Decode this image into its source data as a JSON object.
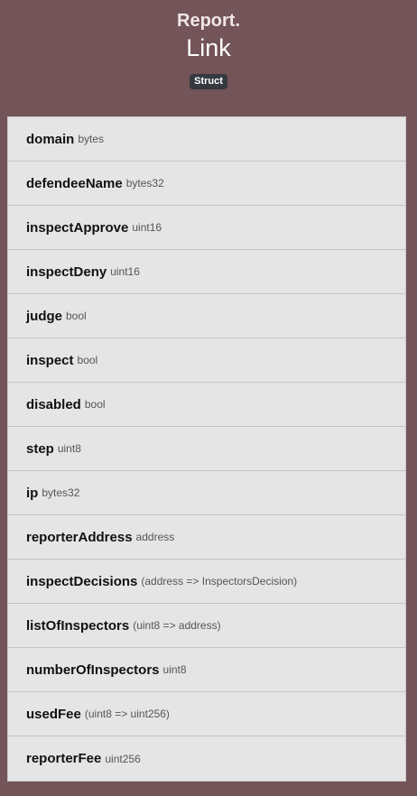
{
  "header": {
    "parent": "Report.",
    "title": "Link",
    "badge": "Struct"
  },
  "fields": [
    {
      "name": "domain",
      "type": "bytes"
    },
    {
      "name": "defendeeName",
      "type": "bytes32"
    },
    {
      "name": "inspectApprove",
      "type": "uint16"
    },
    {
      "name": "inspectDeny",
      "type": "uint16"
    },
    {
      "name": "judge",
      "type": "bool"
    },
    {
      "name": "inspect",
      "type": "bool"
    },
    {
      "name": "disabled",
      "type": "bool"
    },
    {
      "name": "step",
      "type": "uint8"
    },
    {
      "name": "ip",
      "type": "bytes32"
    },
    {
      "name": "reporterAddress",
      "type": "address"
    },
    {
      "name": "inspectDecisions",
      "type": "(address => InspectorsDecision)"
    },
    {
      "name": "listOfInspectors",
      "type": "(uint8 => address)"
    },
    {
      "name": "numberOfInspectors",
      "type": "uint8"
    },
    {
      "name": "usedFee",
      "type": "(uint8 => uint256)"
    },
    {
      "name": "reporterFee",
      "type": "uint256"
    }
  ]
}
